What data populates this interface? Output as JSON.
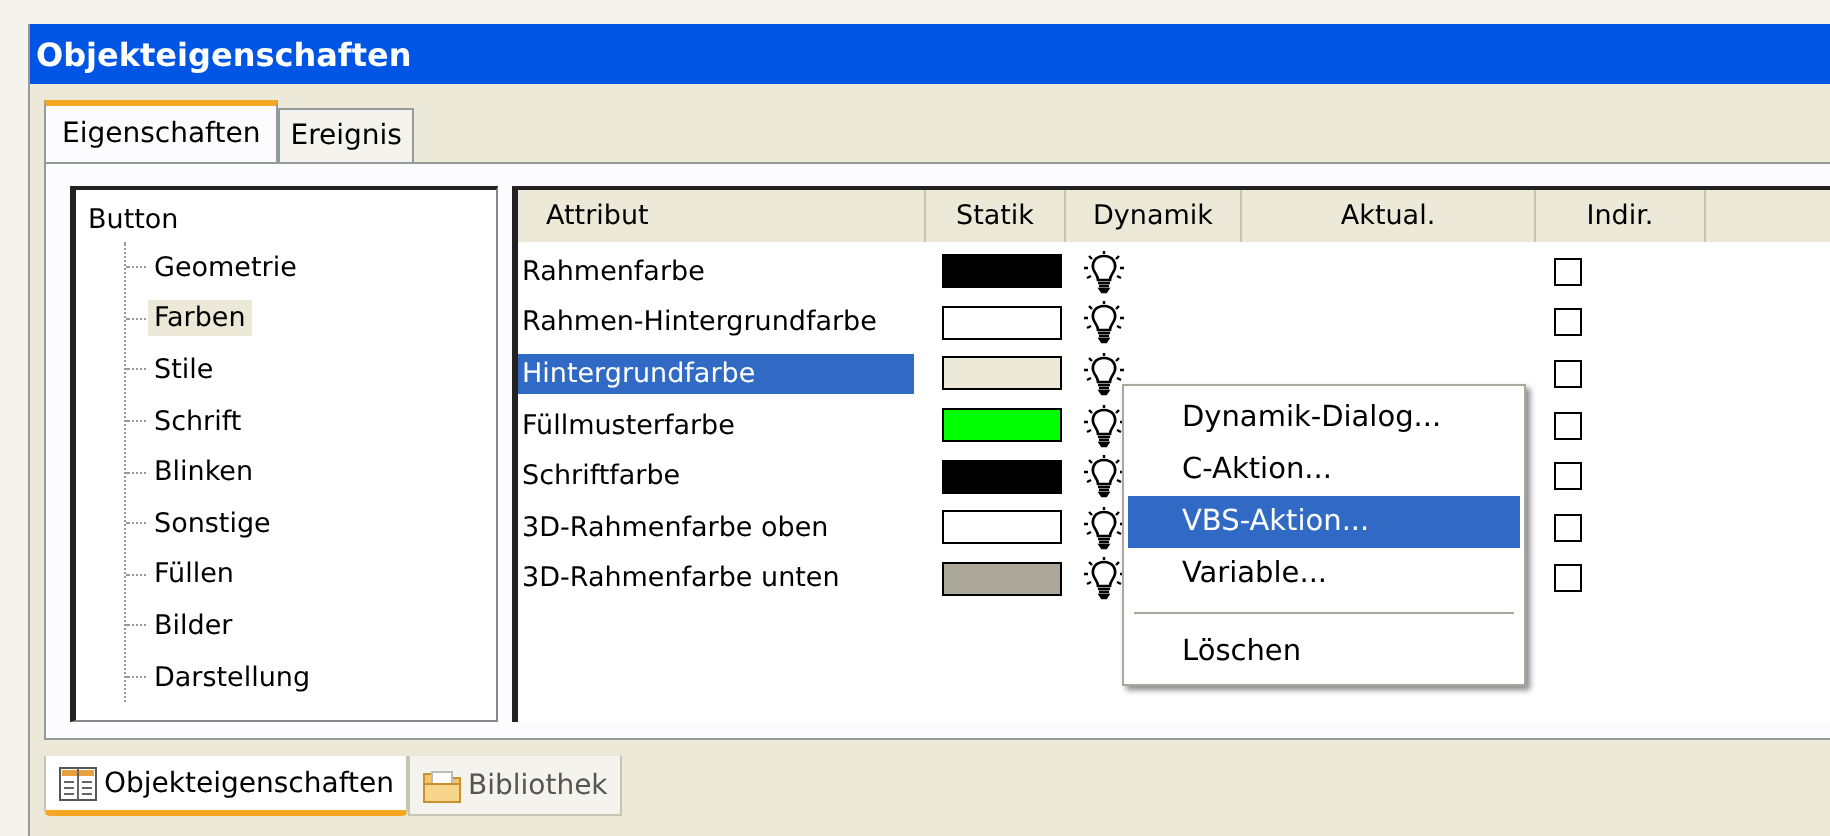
{
  "window": {
    "title": "Objekteigenschaften"
  },
  "tabs": [
    {
      "label": "Eigenschaften",
      "selected": true
    },
    {
      "label": "Ereignis",
      "selected": false
    }
  ],
  "tree": {
    "label": "Button",
    "children": [
      {
        "label": "Geometrie",
        "selected": false
      },
      {
        "label": "Farben",
        "selected": true
      },
      {
        "label": "Stile",
        "selected": false
      },
      {
        "label": "Schrift",
        "selected": false
      },
      {
        "label": "Blinken",
        "selected": false
      },
      {
        "label": "Sonstige",
        "selected": false
      },
      {
        "label": "Füllen",
        "selected": false
      },
      {
        "label": "Bilder",
        "selected": false
      },
      {
        "label": "Darstellung",
        "selected": false
      }
    ]
  },
  "table": {
    "columns": [
      "Attribut",
      "Statik",
      "Dynamik",
      "Aktual.",
      "Indir."
    ],
    "rows": [
      {
        "attribute": "Rahmenfarbe",
        "color": "#000000",
        "selected": false,
        "indirect": false
      },
      {
        "attribute": "Rahmen-Hintergrundfarbe",
        "color": "#ffffff",
        "selected": false,
        "indirect": false
      },
      {
        "attribute": "Hintergrundfarbe",
        "color": "#ece9d8",
        "selected": true,
        "indirect": false
      },
      {
        "attribute": "Füllmusterfarbe",
        "color": "#00ff00",
        "selected": false,
        "indirect": false
      },
      {
        "attribute": "Schriftfarbe",
        "color": "#000000",
        "selected": false,
        "indirect": false
      },
      {
        "attribute": "3D-Rahmenfarbe oben",
        "color": "#ffffff",
        "selected": false,
        "indirect": false
      },
      {
        "attribute": "3D-Rahmenfarbe unten",
        "color": "#aca899",
        "selected": false,
        "indirect": false
      }
    ]
  },
  "context_menu": [
    {
      "kind": "item",
      "label": "Dynamik-Dialog...",
      "selected": false
    },
    {
      "kind": "item",
      "label": "C-Aktion...",
      "selected": false
    },
    {
      "kind": "item",
      "label": "VBS-Aktion...",
      "selected": true
    },
    {
      "kind": "item",
      "label": "Variable...",
      "selected": false
    },
    {
      "kind": "separator"
    },
    {
      "kind": "item",
      "label": "Löschen",
      "selected": false
    }
  ],
  "bottom_tabs": [
    {
      "kind": "panel",
      "label": "Objekteigenschaften",
      "selected": true
    },
    {
      "kind": "folder",
      "label": "Bibliothek",
      "selected": false
    }
  ]
}
